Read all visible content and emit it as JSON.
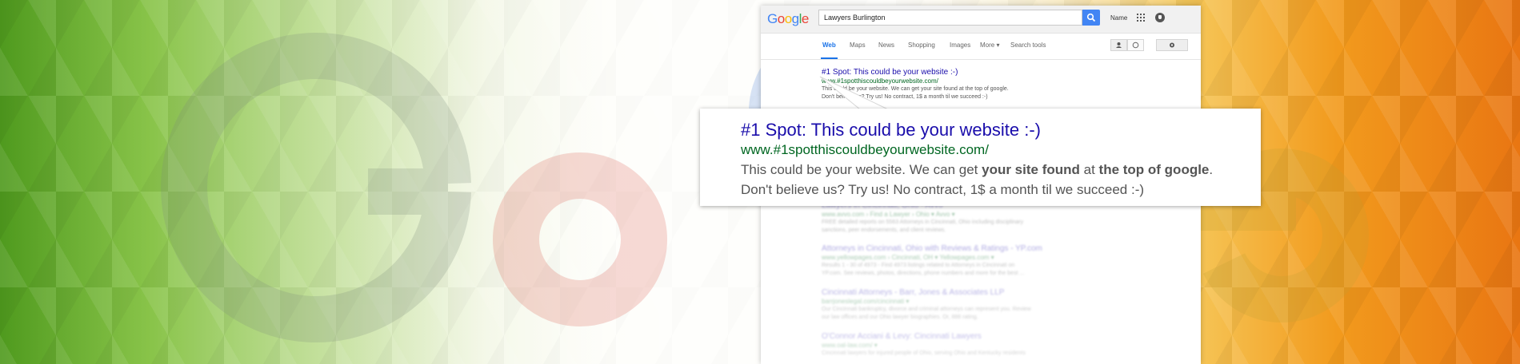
{
  "browser": {
    "logo": "Google",
    "search_value": "Lawyers Burlington",
    "user_name": "Name",
    "tabs": [
      "Web",
      "Maps",
      "News",
      "Shopping",
      "Images",
      "More ▾",
      "Search tools"
    ],
    "active_tab": "Web"
  },
  "top_result": {
    "title": "#1 Spot: This could be your website :-)",
    "url": "www.#1spotthiscouldbeyourwebsite.com/",
    "snippet_line1": "This could be your website. We can get your site found at the top of google.",
    "snippet_line2": "Don't believe us? Try us! No contract, 1$ a month til we succeed :-)"
  },
  "callout": {
    "title": "#1 Spot: This could be your website :-)",
    "url": "www.#1spotthiscouldbeyourwebsite.com/",
    "snippet_a": "This could be your website. We can get ",
    "snippet_b": "your site found",
    "snippet_c": " at ",
    "snippet_d": "the top of google",
    "snippet_e": ".",
    "snippet_line2": "Don't believe us? Try us! No contract, 1$ a month til we succeed :-)"
  },
  "results": [
    {
      "title": "Lawyers in Cincinnati, Ohio - Avvo",
      "url": "www.avvo.com › Find a Lawyer › Ohio ▾  Avvo ▾",
      "snippet1": "FREE detailed reports on 5563 Attorneys in Cincinnati, Ohio including disciplinary",
      "snippet2": "sanctions, peer endorsements, and client reviews."
    },
    {
      "title": "Attorneys in Cincinnati, Ohio with Reviews & Ratings - YP.com",
      "url": "www.yellowpages.com › Cincinnati, OH ▾  Yellowpages.com ▾",
      "snippet1": "Results 1 - 30 of 4973 - Find 4973 listings related to Attorneys in Cincinnati on",
      "snippet2": "YP.com. See reviews, photos, directions, phone numbers and more for the best ..."
    },
    {
      "title": "Cincinnati Attorneys - Barr, Jones & Associates LLP",
      "url": "barrjoneslegal.com/cincinnati ▾",
      "snippet1": "Our Cincinnati bankruptcy, divorce and criminal attorneys can represent you. Review",
      "snippet2": "our law offices and our Ohio lawyer biographies. Or, 888 rating."
    },
    {
      "title": "O'Connor Acciani & Levy: Cincinnati Lawyers",
      "url": "www.oal-law.com/ ▾",
      "snippet1": "Cincinnati lawyers for injured people of Ohio, serving Ohio and Kentucky residents",
      "snippet2": ""
    }
  ],
  "colors": {
    "title_blue": "#1a0dab",
    "url_green": "#006621",
    "snippet_gray": "#545454",
    "accent_blue": "#4285f4"
  }
}
